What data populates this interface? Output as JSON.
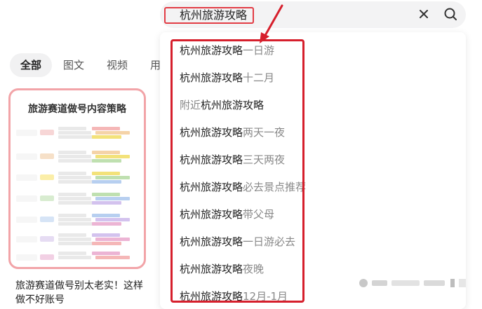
{
  "search": {
    "query": "杭州旅游攻略",
    "clear_icon": "close-icon",
    "search_icon": "search-icon"
  },
  "tabs": [
    {
      "label": "全部",
      "active": true
    },
    {
      "label": "图文",
      "active": false
    },
    {
      "label": "视频",
      "active": false
    },
    {
      "label": "用户",
      "active": false
    }
  ],
  "card": {
    "image_title": "旅游赛道做号内容策略",
    "title": "旅游赛道做号别太老实！这样做不好账号"
  },
  "suggestions": [
    {
      "prefix": "",
      "highlight": "杭州旅游攻略",
      "rest": "一日游"
    },
    {
      "prefix": "",
      "highlight": "杭州旅游攻略",
      "rest": "十二月"
    },
    {
      "prefix": "附近",
      "highlight": "杭州旅游攻略",
      "rest": ""
    },
    {
      "prefix": "",
      "highlight": "杭州旅游攻略",
      "rest": "两天一夜"
    },
    {
      "prefix": "",
      "highlight": "杭州旅游攻略",
      "rest": "三天两夜"
    },
    {
      "prefix": "",
      "highlight": "杭州旅游攻略",
      "rest": "必去景点推荐"
    },
    {
      "prefix": "",
      "highlight": "杭州旅游攻略",
      "rest": "带父母"
    },
    {
      "prefix": "",
      "highlight": "杭州旅游攻略",
      "rest": "一日游必去"
    },
    {
      "prefix": "",
      "highlight": "杭州旅游攻略",
      "rest": "夜晚"
    },
    {
      "prefix": "",
      "highlight": "杭州旅游攻略",
      "rest": "12月-1月"
    }
  ],
  "colors": {
    "annotation_red": "#d61f2c",
    "card_border": "#f2a4a8",
    "suggestion_highlight": "#222222",
    "suggestion_rest": "#888888"
  }
}
